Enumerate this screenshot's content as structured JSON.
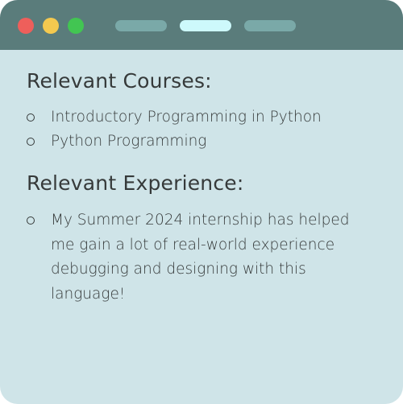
{
  "window": {
    "colors": {
      "titlebar": "#5a7c7b",
      "body": "#cfe4e8",
      "close": "#ee5f5b",
      "minimize": "#f4c94f",
      "maximize": "#42c552",
      "tab_inactive": "#7aa9a8",
      "tab_active": "#cdf9fb",
      "text": "#363a3a"
    }
  },
  "courses": {
    "heading": "Relevant Courses:",
    "items": [
      "Introductory Programming in Python",
      "Python Programming"
    ]
  },
  "experience": {
    "heading": "Relevant Experience:",
    "items": [
      "My Summer 2024 internship has helped me gain a lot of real-world experience debugging and designing with this language!"
    ]
  }
}
